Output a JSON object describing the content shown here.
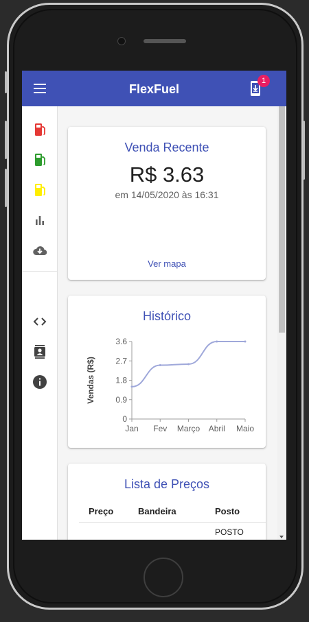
{
  "app": {
    "title": "FlexFuel",
    "badge_count": "1"
  },
  "recent_sale": {
    "title": "Venda Recente",
    "price": "R$ 3.63",
    "datetime": "em 14/05/2020 às 16:31",
    "map_link": "Ver mapa"
  },
  "history": {
    "title": "Histórico",
    "chart_data": {
      "type": "line",
      "x": [
        "Jan",
        "Fev",
        "Março",
        "Abril",
        "Maio"
      ],
      "values": [
        1.5,
        2.5,
        2.55,
        3.6,
        3.6
      ],
      "ylabel": "Vendas (R$)",
      "yticks": [
        "0",
        "0.9",
        "1.8",
        "2.7",
        "3.6"
      ],
      "ylim": [
        0,
        3.6
      ],
      "line_color": "#9fa8da"
    }
  },
  "price_list": {
    "title": "Lista de Preços",
    "headers": [
      "Preço",
      "Bandeira",
      "Posto"
    ],
    "rows": [
      [
        "",
        "",
        "POSTO"
      ]
    ]
  },
  "colors": {
    "primary": "#3f51b5",
    "accent": "#e91e63",
    "fuel_red": "#e53935",
    "fuel_green": "#2e9c2e",
    "fuel_yellow": "#ffee00",
    "icon_grey": "#616161"
  }
}
